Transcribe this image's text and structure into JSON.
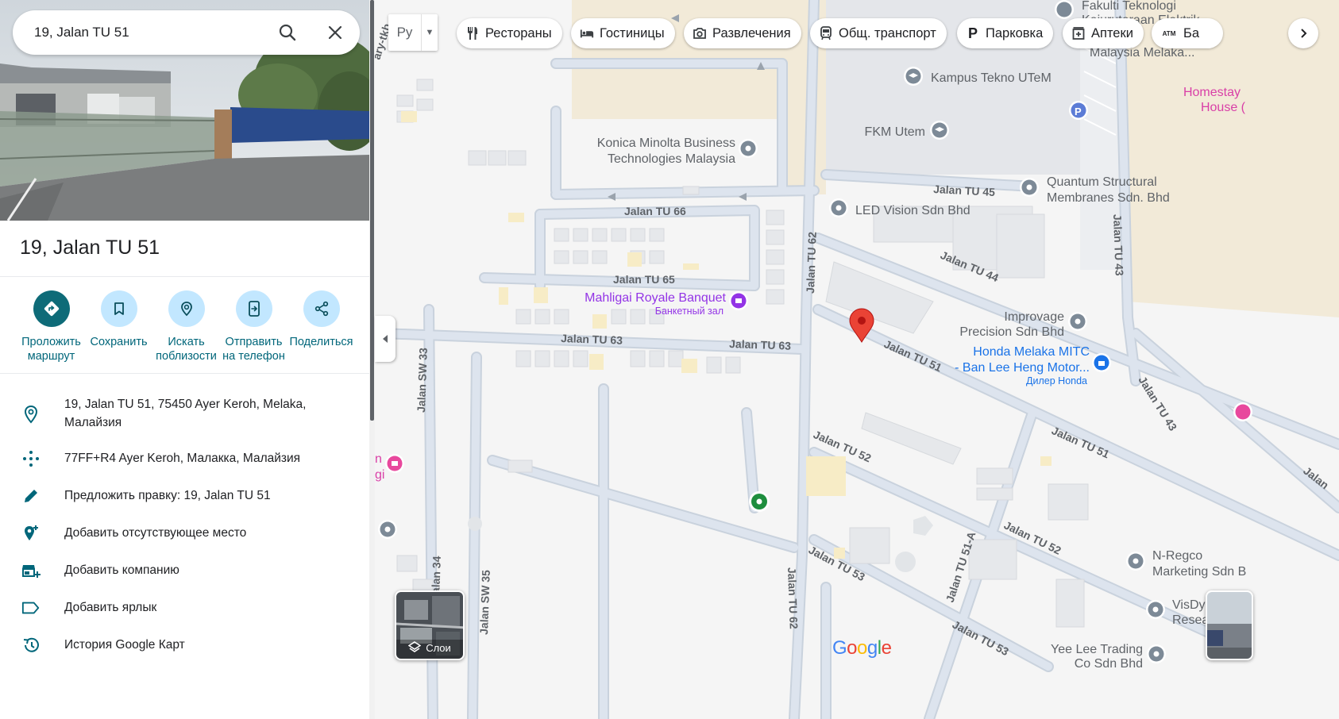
{
  "search": {
    "value": "19, Jalan TU 51"
  },
  "place": {
    "title": "19, Jalan TU 51"
  },
  "actions": [
    {
      "label": "Проложить маршрут",
      "icon": "directions-icon"
    },
    {
      "label": "Сохранить",
      "icon": "bookmark-icon"
    },
    {
      "label": "Искать поблизости",
      "icon": "nearby-icon"
    },
    {
      "label": "Отправить на телефон",
      "icon": "send-to-phone-icon"
    },
    {
      "label": "Поделиться",
      "icon": "share-icon"
    }
  ],
  "info": [
    {
      "text": "19, Jalan TU 51, 75450 Ayer Keroh, Melaka, Малайзия",
      "icon": "location-pin-icon"
    },
    {
      "text": "77FF+R4 Ayer Keroh, Малакка, Малайзия",
      "icon": "plus-code-icon"
    },
    {
      "text": "Предложить правку: 19, Jalan TU 51",
      "icon": "pencil-icon"
    },
    {
      "text": "Добавить отсутствующее место",
      "icon": "add-place-icon"
    },
    {
      "text": "Добавить компанию",
      "icon": "add-business-icon"
    },
    {
      "text": "Добавить ярлык",
      "icon": "label-icon"
    },
    {
      "text": "История Google Карт",
      "icon": "history-icon"
    }
  ],
  "map": {
    "lang_chip": "Ру",
    "chips": [
      {
        "label": "Рестораны",
        "icon": "restaurant-icon"
      },
      {
        "label": "Гостиницы",
        "icon": "hotel-icon"
      },
      {
        "label": "Развлечения",
        "icon": "camera-icon"
      },
      {
        "label": "Общ. транспорт",
        "icon": "transit-icon"
      },
      {
        "label": "Парковка",
        "icon": "parking-icon"
      },
      {
        "label": "Аптеки",
        "icon": "pharmacy-icon"
      },
      {
        "label": "Ба",
        "icon": "atm-icon",
        "icon_text": "ATM"
      }
    ],
    "layers_label": "Слои",
    "google_logo": [
      "G",
      "o",
      "o",
      "g",
      "l",
      "e"
    ],
    "street_labels": [
      "Jalan TU 66",
      "Jalan TU 65",
      "Jalan TU 63",
      "Jalan TU 63",
      "Jalan TU 62",
      "Jalan TU 62",
      "Jalan TU 45",
      "Jalan TU 44",
      "Jalan TU 43",
      "Jalan TU 43",
      "Jalan TU 51",
      "Jalan TU 51",
      "Jalan TU 52",
      "Jalan TU 52",
      "Jalan TU 53",
      "Jalan TU 53",
      "Jalan TU 51-A",
      "Jalan SW 33",
      "Jalan SW 35",
      "Jalan 34",
      "ary-tkb",
      "Jalan"
    ],
    "places": [
      {
        "name": "Konica Minolta Business",
        "name2": "Technologies Malaysia"
      },
      {
        "name": "Kampus Tekno UTeM"
      },
      {
        "name": "FKM Utem"
      },
      {
        "name": "Quantum Structural",
        "name2": "Membranes Sdn. Bhd"
      },
      {
        "name": "LED Vision Sdn Bhd"
      },
      {
        "name": "Mahligai Royale Banquet",
        "sub": "Банкетный зал"
      },
      {
        "name": "Improvage",
        "name2": "Precision Sdn Bhd"
      },
      {
        "name": "Honda Melaka MITC",
        "name2": "- Ban Lee Heng Motor...",
        "sub": "Дилер Honda"
      },
      {
        "name": "Homestay",
        "name2": "House ("
      },
      {
        "name": "Fakulti Teknologi",
        "name2": "Kejuruteraan Elektrik",
        "name3": "Malaysia Melaka..."
      },
      {
        "name": "N-Regco",
        "name2": "Marketing Sdn B"
      },
      {
        "name": "VisDy",
        "name2": "Resea"
      },
      {
        "name": "Yee Lee Trading",
        "name2": "Co Sdn Bhd"
      },
      {
        "name": "n",
        "name2": "gi"
      }
    ],
    "colors": {
      "accent": "#0e6b78",
      "road": "#dce3ec",
      "road_edge": "#c8d2de",
      "building": "#e8e8e8",
      "campus": "#f2ead8",
      "poi_gray": "#7d8a97",
      "poi_purple": "#9334e6",
      "poi_blue": "#1a73e8",
      "pin_red": "#ea4335"
    }
  }
}
